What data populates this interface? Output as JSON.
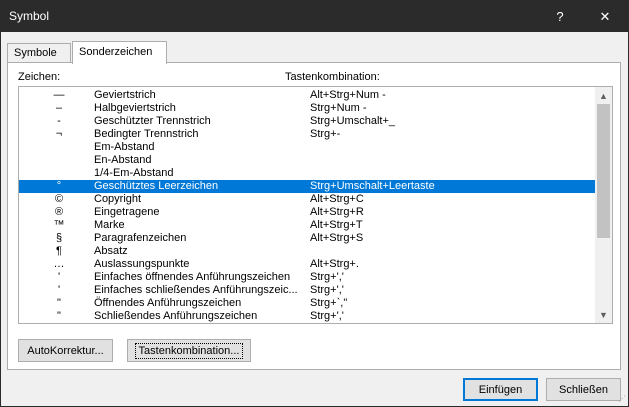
{
  "window": {
    "title": "Symbol",
    "help_glyph": "?",
    "close_glyph": "✕"
  },
  "tabs": [
    {
      "label": "Symbole"
    },
    {
      "label": "Sonderzeichen"
    }
  ],
  "columns": {
    "character": "Zeichen:",
    "shortcut": "Tastenkombination:"
  },
  "rows": [
    {
      "symbol": "—",
      "name": "Geviertstrich",
      "shortcut": "Alt+Strg+Num -"
    },
    {
      "symbol": "–",
      "name": "Halbgeviertstrich",
      "shortcut": "Strg+Num -"
    },
    {
      "symbol": "-",
      "name": "Geschützter Trennstrich",
      "shortcut": "Strg+Umschalt+_"
    },
    {
      "symbol": "¬",
      "name": "Bedingter Trennstrich",
      "shortcut": "Strg+-"
    },
    {
      "symbol": "",
      "name": "Em-Abstand",
      "shortcut": ""
    },
    {
      "symbol": "",
      "name": "En-Abstand",
      "shortcut": ""
    },
    {
      "symbol": "",
      "name": "1/4-Em-Abstand",
      "shortcut": ""
    },
    {
      "symbol": "°",
      "name": "Geschütztes Leerzeichen",
      "shortcut": "Strg+Umschalt+Leertaste"
    },
    {
      "symbol": "©",
      "name": "Copyright",
      "shortcut": "Alt+Strg+C"
    },
    {
      "symbol": "®",
      "name": "Eingetragene",
      "shortcut": "Alt+Strg+R"
    },
    {
      "symbol": "™",
      "name": "Marke",
      "shortcut": "Alt+Strg+T"
    },
    {
      "symbol": "§",
      "name": "Paragrafenzeichen",
      "shortcut": "Alt+Strg+S"
    },
    {
      "symbol": "¶",
      "name": "Absatz",
      "shortcut": ""
    },
    {
      "symbol": "…",
      "name": "Auslassungspunkte",
      "shortcut": "Alt+Strg+."
    },
    {
      "symbol": "'",
      "name": "Einfaches öffnendes Anführungszeichen",
      "shortcut": "Strg+','"
    },
    {
      "symbol": "'",
      "name": "Einfaches schließendes Anführungszeic...",
      "shortcut": "Strg+','"
    },
    {
      "symbol": "\"",
      "name": "Öffnendes Anführungszeichen",
      "shortcut": "Strg+`,\""
    },
    {
      "symbol": "\"",
      "name": "Schließendes Anführungszeichen",
      "shortcut": "Strg+','"
    }
  ],
  "selected_row_index": 7,
  "scrollbar": {
    "up_glyph": "▲",
    "down_glyph": "▼"
  },
  "buttons": {
    "autokorrektur": "AutoKorrektur...",
    "tastenkombination": "Tastenkombination...",
    "einfuegen": "Einfügen",
    "schliessen": "Schließen"
  },
  "colors": {
    "titlebar": "#2b2b2b",
    "selection": "#0078d7",
    "default_button_border": "#0078d7"
  }
}
